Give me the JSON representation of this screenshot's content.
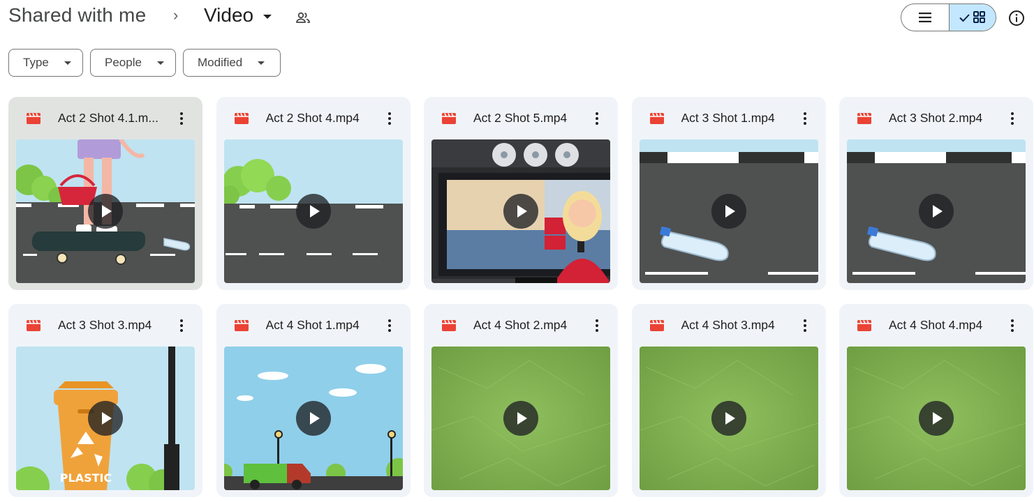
{
  "breadcrumb": {
    "root": "Shared with me",
    "separator": "›",
    "current": "Video"
  },
  "view_toggle": {
    "list_icon": "list-view-icon",
    "grid_icon": "grid-view-icon",
    "active": "grid"
  },
  "filters": [
    {
      "label": "Type"
    },
    {
      "label": "People"
    },
    {
      "label": "Modified"
    }
  ],
  "files": [
    {
      "name": "Act 2 Shot 4.1.m...",
      "thumbnail": "skateboard-street",
      "selected": true
    },
    {
      "name": "Act 2 Shot 4.mp4",
      "thumbnail": "empty-street"
    },
    {
      "name": "Act 2 Shot 5.mp4",
      "thumbnail": "news-reporter"
    },
    {
      "name": "Act 3 Shot 1.mp4",
      "thumbnail": "bottle-road"
    },
    {
      "name": "Act 3 Shot 2.mp4",
      "thumbnail": "bottle-road"
    },
    {
      "name": "Act 3 Shot 3.mp4",
      "thumbnail": "recycle-bin"
    },
    {
      "name": "Act 4 Shot 1.mp4",
      "thumbnail": "recycle-truck"
    },
    {
      "name": "Act 4 Shot 2.mp4",
      "thumbnail": "green-paper"
    },
    {
      "name": "Act 4 Shot 3.mp4",
      "thumbnail": "green-paper"
    },
    {
      "name": "Act 4 Shot 4.mp4",
      "thumbnail": "green-paper"
    }
  ],
  "thumbnail_text": {
    "recycle_bin_label": "PLASTIC"
  },
  "colors": {
    "accent": "#c2e7ff",
    "video_icon": "#ea4335",
    "card_bg": "#f0f4f9",
    "card_selected_bg": "#e1e3e1"
  }
}
